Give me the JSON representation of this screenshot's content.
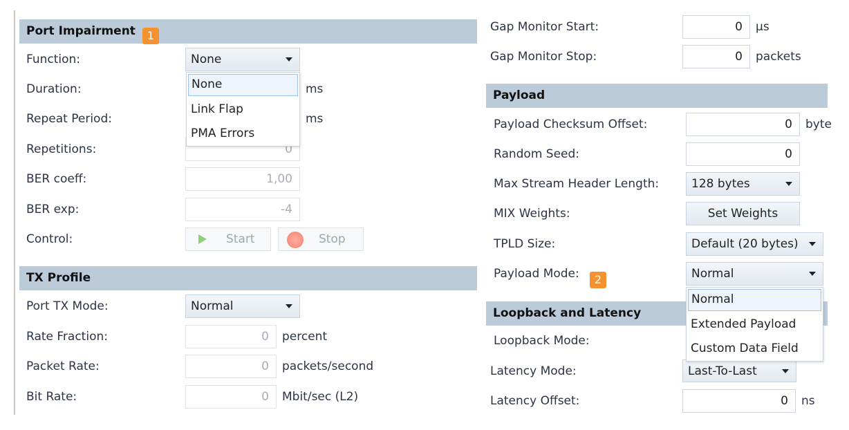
{
  "port_impairment": {
    "title": "Port Impairment",
    "badge": "1",
    "function": {
      "label": "Function:",
      "value": "None",
      "options": [
        "None",
        "Link Flap",
        "PMA Errors"
      ]
    },
    "duration": {
      "label": "Duration:",
      "unit": "ms"
    },
    "repeat_period": {
      "label": "Repeat Period:",
      "unit": "ms"
    },
    "repetitions": {
      "label": "Repetitions:",
      "value": "0"
    },
    "ber_coeff": {
      "label": "BER coeff:",
      "value": "1,00"
    },
    "ber_exp": {
      "label": "BER exp:",
      "value": "-4"
    },
    "control": {
      "label": "Control:",
      "start": "Start",
      "stop": "Stop"
    }
  },
  "tx_profile": {
    "title": "TX Profile",
    "port_tx_mode": {
      "label": "Port TX Mode:",
      "value": "Normal"
    },
    "rate_fraction": {
      "label": "Rate Fraction:",
      "value": "0",
      "unit": "percent"
    },
    "packet_rate": {
      "label": "Packet Rate:",
      "value": "0",
      "unit": "packets/second"
    },
    "bit_rate": {
      "label": "Bit Rate:",
      "value": "0",
      "unit": "Mbit/sec (L2)"
    }
  },
  "gap": {
    "start": {
      "label": "Gap Monitor Start:",
      "value": "0",
      "unit": "µs"
    },
    "stop": {
      "label": "Gap Monitor Stop:",
      "value": "0",
      "unit": "packets"
    }
  },
  "payload": {
    "title": "Payload",
    "checksum_offset": {
      "label": "Payload Checksum Offset:",
      "value": "0",
      "unit": "byte"
    },
    "random_seed": {
      "label": "Random Seed:",
      "value": "0"
    },
    "max_header": {
      "label": "Max Stream Header Length:",
      "value": "128 bytes"
    },
    "mix_weights": {
      "label": "MIX Weights:",
      "button": "Set Weights"
    },
    "tpld_size": {
      "label": "TPLD Size:",
      "value": "Default (20 bytes)"
    },
    "mode": {
      "label": "Payload Mode:",
      "badge": "2",
      "value": "Normal",
      "options": [
        "Normal",
        "Extended Payload",
        "Custom Data Field"
      ]
    }
  },
  "loopback": {
    "title": "Loopback and Latency",
    "loopback_mode": {
      "label": "Loopback Mode:"
    },
    "latency_mode": {
      "label": "Latency Mode:",
      "value": "Last-To-Last"
    },
    "latency_offset": {
      "label": "Latency Offset:",
      "value": "0",
      "unit": "ns"
    }
  },
  "colors": {
    "header_bg": "#bccbd9",
    "badge": "#f5922f"
  }
}
